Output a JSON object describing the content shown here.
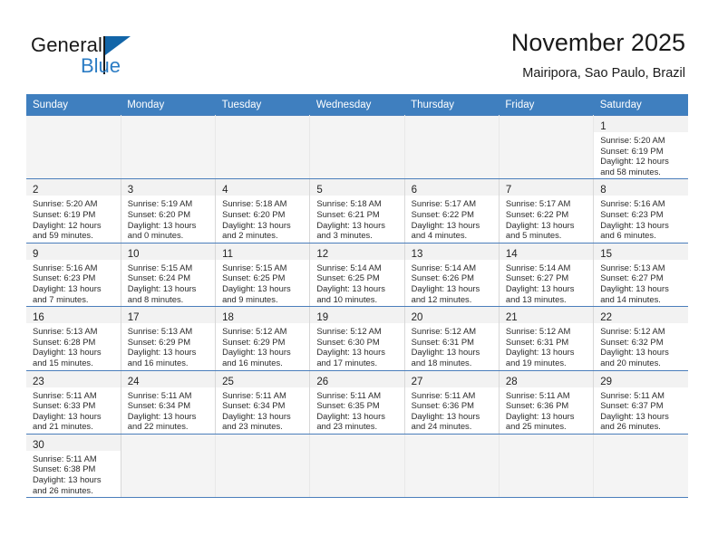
{
  "brand": {
    "word_general": "General",
    "word_blue": "Blue",
    "flag_icon": "blue-triangle-flag-icon"
  },
  "header": {
    "title": "November 2025",
    "subtitle": "Mairipora, Sao Paulo, Brazil"
  },
  "colors": {
    "header_blue": "#3f7fbf",
    "row_divider_blue": "#4a7ebb",
    "brand_blue": "#2b7cc4",
    "flag_blue": "#1265a8",
    "daynum_band": "#f2f2f2",
    "empty_cell": "#f4f4f4"
  },
  "labels": {
    "sunrise_prefix": "Sunrise:",
    "sunset_prefix": "Sunset:",
    "daylight_prefix": "Daylight:"
  },
  "weekday_headers": [
    "Sunday",
    "Monday",
    "Tuesday",
    "Wednesday",
    "Thursday",
    "Friday",
    "Saturday"
  ],
  "weeks": [
    [
      {
        "empty": true
      },
      {
        "empty": true
      },
      {
        "empty": true
      },
      {
        "empty": true
      },
      {
        "empty": true
      },
      {
        "empty": true
      },
      {
        "day": "1",
        "sunrise": "Sunrise: 5:20 AM",
        "sunset": "Sunset: 6:19 PM",
        "daylight_1": "Daylight: 12 hours",
        "daylight_2": "and 58 minutes."
      }
    ],
    [
      {
        "day": "2",
        "sunrise": "Sunrise: 5:20 AM",
        "sunset": "Sunset: 6:19 PM",
        "daylight_1": "Daylight: 12 hours",
        "daylight_2": "and 59 minutes."
      },
      {
        "day": "3",
        "sunrise": "Sunrise: 5:19 AM",
        "sunset": "Sunset: 6:20 PM",
        "daylight_1": "Daylight: 13 hours",
        "daylight_2": "and 0 minutes."
      },
      {
        "day": "4",
        "sunrise": "Sunrise: 5:18 AM",
        "sunset": "Sunset: 6:20 PM",
        "daylight_1": "Daylight: 13 hours",
        "daylight_2": "and 2 minutes."
      },
      {
        "day": "5",
        "sunrise": "Sunrise: 5:18 AM",
        "sunset": "Sunset: 6:21 PM",
        "daylight_1": "Daylight: 13 hours",
        "daylight_2": "and 3 minutes."
      },
      {
        "day": "6",
        "sunrise": "Sunrise: 5:17 AM",
        "sunset": "Sunset: 6:22 PM",
        "daylight_1": "Daylight: 13 hours",
        "daylight_2": "and 4 minutes."
      },
      {
        "day": "7",
        "sunrise": "Sunrise: 5:17 AM",
        "sunset": "Sunset: 6:22 PM",
        "daylight_1": "Daylight: 13 hours",
        "daylight_2": "and 5 minutes."
      },
      {
        "day": "8",
        "sunrise": "Sunrise: 5:16 AM",
        "sunset": "Sunset: 6:23 PM",
        "daylight_1": "Daylight: 13 hours",
        "daylight_2": "and 6 minutes."
      }
    ],
    [
      {
        "day": "9",
        "sunrise": "Sunrise: 5:16 AM",
        "sunset": "Sunset: 6:23 PM",
        "daylight_1": "Daylight: 13 hours",
        "daylight_2": "and 7 minutes."
      },
      {
        "day": "10",
        "sunrise": "Sunrise: 5:15 AM",
        "sunset": "Sunset: 6:24 PM",
        "daylight_1": "Daylight: 13 hours",
        "daylight_2": "and 8 minutes."
      },
      {
        "day": "11",
        "sunrise": "Sunrise: 5:15 AM",
        "sunset": "Sunset: 6:25 PM",
        "daylight_1": "Daylight: 13 hours",
        "daylight_2": "and 9 minutes."
      },
      {
        "day": "12",
        "sunrise": "Sunrise: 5:14 AM",
        "sunset": "Sunset: 6:25 PM",
        "daylight_1": "Daylight: 13 hours",
        "daylight_2": "and 10 minutes."
      },
      {
        "day": "13",
        "sunrise": "Sunrise: 5:14 AM",
        "sunset": "Sunset: 6:26 PM",
        "daylight_1": "Daylight: 13 hours",
        "daylight_2": "and 12 minutes."
      },
      {
        "day": "14",
        "sunrise": "Sunrise: 5:14 AM",
        "sunset": "Sunset: 6:27 PM",
        "daylight_1": "Daylight: 13 hours",
        "daylight_2": "and 13 minutes."
      },
      {
        "day": "15",
        "sunrise": "Sunrise: 5:13 AM",
        "sunset": "Sunset: 6:27 PM",
        "daylight_1": "Daylight: 13 hours",
        "daylight_2": "and 14 minutes."
      }
    ],
    [
      {
        "day": "16",
        "sunrise": "Sunrise: 5:13 AM",
        "sunset": "Sunset: 6:28 PM",
        "daylight_1": "Daylight: 13 hours",
        "daylight_2": "and 15 minutes."
      },
      {
        "day": "17",
        "sunrise": "Sunrise: 5:13 AM",
        "sunset": "Sunset: 6:29 PM",
        "daylight_1": "Daylight: 13 hours",
        "daylight_2": "and 16 minutes."
      },
      {
        "day": "18",
        "sunrise": "Sunrise: 5:12 AM",
        "sunset": "Sunset: 6:29 PM",
        "daylight_1": "Daylight: 13 hours",
        "daylight_2": "and 16 minutes."
      },
      {
        "day": "19",
        "sunrise": "Sunrise: 5:12 AM",
        "sunset": "Sunset: 6:30 PM",
        "daylight_1": "Daylight: 13 hours",
        "daylight_2": "and 17 minutes."
      },
      {
        "day": "20",
        "sunrise": "Sunrise: 5:12 AM",
        "sunset": "Sunset: 6:31 PM",
        "daylight_1": "Daylight: 13 hours",
        "daylight_2": "and 18 minutes."
      },
      {
        "day": "21",
        "sunrise": "Sunrise: 5:12 AM",
        "sunset": "Sunset: 6:31 PM",
        "daylight_1": "Daylight: 13 hours",
        "daylight_2": "and 19 minutes."
      },
      {
        "day": "22",
        "sunrise": "Sunrise: 5:12 AM",
        "sunset": "Sunset: 6:32 PM",
        "daylight_1": "Daylight: 13 hours",
        "daylight_2": "and 20 minutes."
      }
    ],
    [
      {
        "day": "23",
        "sunrise": "Sunrise: 5:11 AM",
        "sunset": "Sunset: 6:33 PM",
        "daylight_1": "Daylight: 13 hours",
        "daylight_2": "and 21 minutes."
      },
      {
        "day": "24",
        "sunrise": "Sunrise: 5:11 AM",
        "sunset": "Sunset: 6:34 PM",
        "daylight_1": "Daylight: 13 hours",
        "daylight_2": "and 22 minutes."
      },
      {
        "day": "25",
        "sunrise": "Sunrise: 5:11 AM",
        "sunset": "Sunset: 6:34 PM",
        "daylight_1": "Daylight: 13 hours",
        "daylight_2": "and 23 minutes."
      },
      {
        "day": "26",
        "sunrise": "Sunrise: 5:11 AM",
        "sunset": "Sunset: 6:35 PM",
        "daylight_1": "Daylight: 13 hours",
        "daylight_2": "and 23 minutes."
      },
      {
        "day": "27",
        "sunrise": "Sunrise: 5:11 AM",
        "sunset": "Sunset: 6:36 PM",
        "daylight_1": "Daylight: 13 hours",
        "daylight_2": "and 24 minutes."
      },
      {
        "day": "28",
        "sunrise": "Sunrise: 5:11 AM",
        "sunset": "Sunset: 6:36 PM",
        "daylight_1": "Daylight: 13 hours",
        "daylight_2": "and 25 minutes."
      },
      {
        "day": "29",
        "sunrise": "Sunrise: 5:11 AM",
        "sunset": "Sunset: 6:37 PM",
        "daylight_1": "Daylight: 13 hours",
        "daylight_2": "and 26 minutes."
      }
    ],
    [
      {
        "day": "30",
        "sunrise": "Sunrise: 5:11 AM",
        "sunset": "Sunset: 6:38 PM",
        "daylight_1": "Daylight: 13 hours",
        "daylight_2": "and 26 minutes."
      },
      {
        "empty": true
      },
      {
        "empty": true
      },
      {
        "empty": true
      },
      {
        "empty": true
      },
      {
        "empty": true
      },
      {
        "empty": true
      }
    ]
  ]
}
